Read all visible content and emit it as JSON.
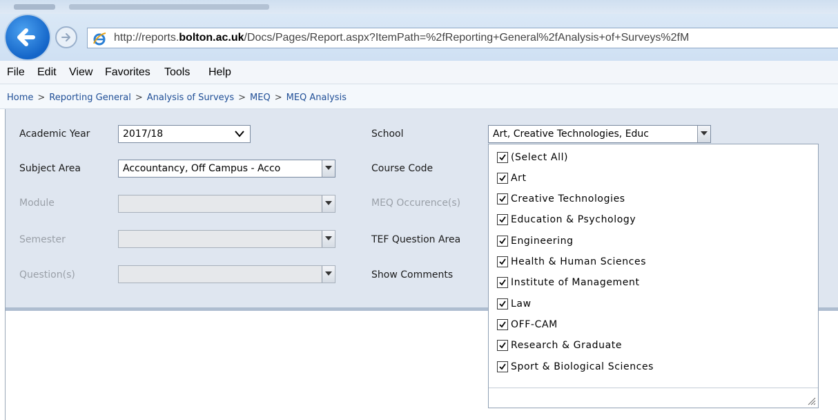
{
  "browser": {
    "address_url": "http://reports.bolton.ac.uk/Docs/Pages/Report.aspx?ItemPath=%2fReporting+General%2fAnalysis+of+Surveys%2fM",
    "address_prefix": "http://reports.",
    "address_host": "bolton.ac.uk",
    "address_path": "/Docs/Pages/Report.aspx?ItemPath=%2fReporting+General%2fAnalysis+of+Surveys%2fM",
    "menu": [
      "File",
      "Edit",
      "View",
      "Favorites",
      "Tools",
      "Help"
    ]
  },
  "breadcrumb": [
    "Home",
    "Reporting General",
    "Analysis of Surveys",
    "MEQ",
    "MEQ Analysis"
  ],
  "breadcrumb_separator": ">",
  "params": {
    "academic_year": {
      "label": "Academic Year",
      "value": "2017/18"
    },
    "subject_area": {
      "label": "Subject Area",
      "value": "Accountancy, Off Campus - Acco"
    },
    "module": {
      "label": "Module",
      "value": ""
    },
    "semester": {
      "label": "Semester",
      "value": ""
    },
    "questions": {
      "label": "Question(s)",
      "value": ""
    },
    "school": {
      "label": "School",
      "value": "Art, Creative Technologies, Educ"
    },
    "course_code": {
      "label": "Course Code"
    },
    "meq_occurrence": {
      "label": "MEQ Occurence(s)"
    },
    "tef_question_area": {
      "label": "TEF Question Area"
    },
    "show_comments": {
      "label": "Show Comments"
    }
  },
  "school_options": [
    {
      "label": "(Select All)",
      "checked": true
    },
    {
      "label": "Art",
      "checked": true
    },
    {
      "label": "Creative Technologies",
      "checked": true
    },
    {
      "label": "Education & Psychology",
      "checked": true
    },
    {
      "label": "Engineering",
      "checked": true
    },
    {
      "label": "Health & Human Sciences",
      "checked": true
    },
    {
      "label": "Institute of Management",
      "checked": true
    },
    {
      "label": "Law",
      "checked": true
    },
    {
      "label": "OFF-CAM",
      "checked": true
    },
    {
      "label": "Research & Graduate",
      "checked": true
    },
    {
      "label": "Sport & Biological Sciences",
      "checked": true
    }
  ],
  "colors": {
    "link": "#1f4e96",
    "panel": "#dfe6f0",
    "disabled_text": "#9aa0a8"
  }
}
